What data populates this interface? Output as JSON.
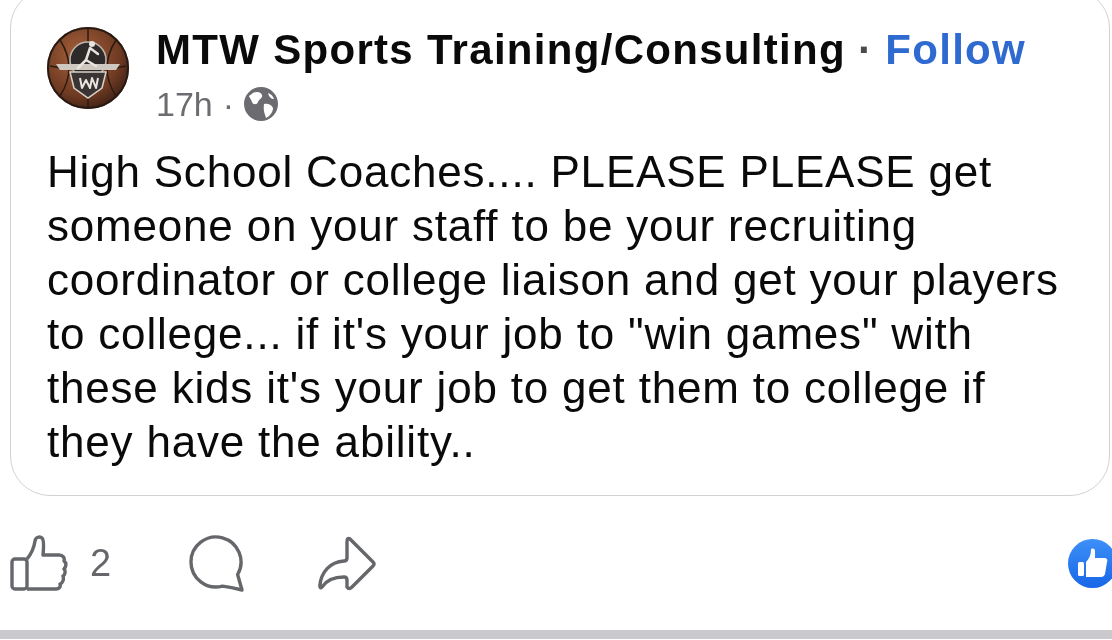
{
  "post": {
    "author": "MTW Sports Training/Consulting",
    "author_separator": "·",
    "follow": "Follow",
    "time": "17h",
    "time_separator": "·",
    "text": "High School Coaches.... PLEASE PLEASE get someone on your staff to be your recruiting coordinator or college liaison and get your players to college... if it's your job to \"win games\" with these kids it's your job to get them to college if they have the ability.."
  },
  "actions": {
    "like_count": "2"
  }
}
